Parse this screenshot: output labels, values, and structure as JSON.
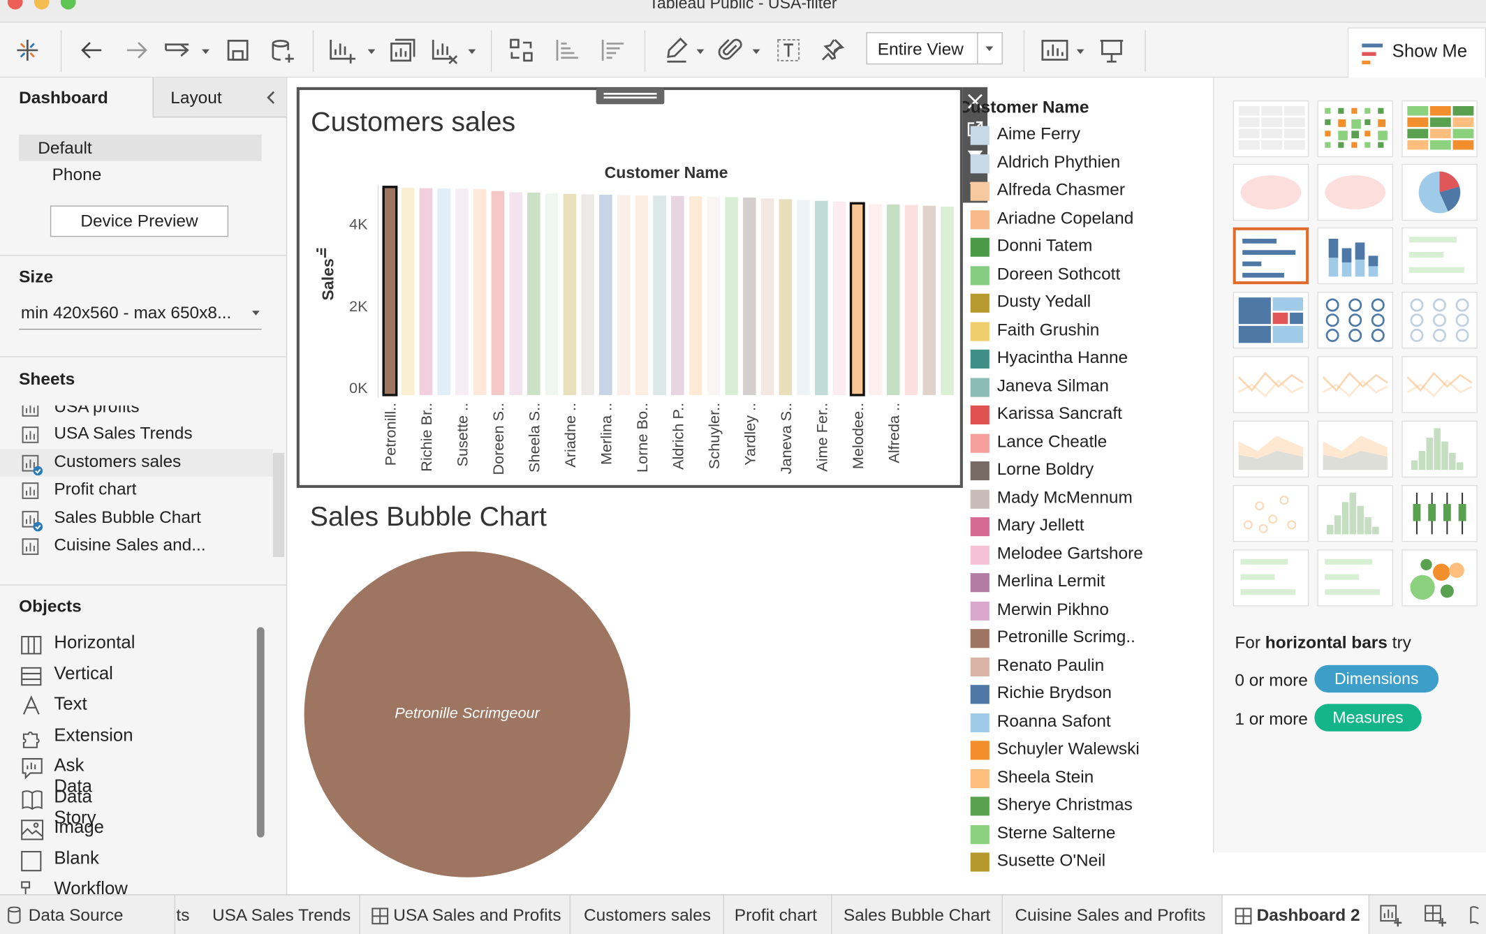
{
  "window": {
    "title": "Tableau Public - USA-filter"
  },
  "toolbar": {
    "fit_select": "Entire View",
    "show_me": "Show Me"
  },
  "sidebar": {
    "tabs": [
      "Dashboard",
      "Layout"
    ],
    "device_options": [
      "Default",
      "Phone"
    ],
    "device_preview_button": "Device Preview",
    "size_header": "Size",
    "size_value": "min 420x560 - max 650x8...",
    "sheets_header": "Sheets",
    "sheets": [
      "USA profits",
      "USA Sales Trends",
      "Customers sales",
      "Profit chart",
      "Sales Bubble Chart",
      "Cuisine Sales and..."
    ],
    "objects_header": "Objects",
    "objects": [
      "Horizontal",
      "Vertical",
      "Text",
      "Extension",
      "Ask Data",
      "Data Story",
      "Image",
      "Blank",
      "Workflow"
    ]
  },
  "customers_chart": {
    "title": "Customers sales"
  },
  "bubble_chart": {
    "title": "Sales Bubble Chart",
    "bubble_label": "Petronille Scrimgeour"
  },
  "chart_data": [
    {
      "type": "bar",
      "title": "Customers sales",
      "xlabel": "Customer Name",
      "ylabel": "Sales",
      "yticks": [
        "4K",
        "2K",
        "0K"
      ],
      "ylim": [
        0,
        5000
      ],
      "categories": [
        "Petronill..",
        "Richie Br..",
        "Susette ..",
        "Doreen S..",
        "Sheela S..",
        "Ariadne ..",
        "Merlina ..",
        "Lorne Bo..",
        "Aldrich P..",
        "Schuyler..",
        "Yardley ..",
        "Janeva S..",
        "Aime Fer..",
        "Melodee..",
        "Alfreda .."
      ],
      "values": [
        4900,
        4880,
        4870,
        4860,
        4860,
        4850,
        4800,
        4770,
        4760,
        4740,
        4730,
        4720,
        4710,
        4700,
        4690,
        4690,
        4680,
        4670,
        4660,
        4650,
        4640,
        4620,
        4600,
        4580,
        4560,
        4540,
        4500,
        4480,
        4470,
        4460,
        4440,
        4420
      ],
      "highlighted": [
        "Petronill..",
        "Aime Fer.."
      ]
    },
    {
      "type": "bubble",
      "title": "Sales Bubble Chart",
      "series": [
        {
          "name": "Petronille Scrimgeour",
          "color": "#9e7560"
        }
      ]
    }
  ],
  "legend": {
    "title": "Customer Name",
    "items": [
      {
        "label": "Aime Ferry",
        "color": "#c8d9e8"
      },
      {
        "label": "Aldrich Phythien",
        "color": "#c8d9e8"
      },
      {
        "label": "Alfreda Chasmer",
        "color": "#f7c9a0"
      },
      {
        "label": "Ariadne Copeland",
        "color": "#f8b98a"
      },
      {
        "label": "Donni Tatem",
        "color": "#4c9a48"
      },
      {
        "label": "Doreen Sothcott",
        "color": "#86cc80"
      },
      {
        "label": "Dusty Yedall",
        "color": "#b79a2f"
      },
      {
        "label": "Faith Grushin",
        "color": "#efcd6c"
      },
      {
        "label": "Hyacintha Hanne",
        "color": "#3f8f86"
      },
      {
        "label": "Janeva Silman",
        "color": "#8cbcb6"
      },
      {
        "label": "Karissa Sancraft",
        "color": "#e05252"
      },
      {
        "label": "Lance Cheatle",
        "color": "#f5a09d"
      },
      {
        "label": "Lorne Boldry",
        "color": "#786b66"
      },
      {
        "label": "Mady McMennum",
        "color": "#c7bcb8"
      },
      {
        "label": "Mary Jellett",
        "color": "#d56b93"
      },
      {
        "label": "Melodee Gartshore",
        "color": "#f6c1d4"
      },
      {
        "label": "Merlina Lermit",
        "color": "#b37ca4"
      },
      {
        "label": "Merwin Pikhno",
        "color": "#d9a8cc"
      },
      {
        "label": "Petronille Scrimg..",
        "color": "#9e7560"
      },
      {
        "label": "Renato Paulin",
        "color": "#d9b4a6"
      },
      {
        "label": "Richie Brydson",
        "color": "#4e79a7"
      },
      {
        "label": "Roanna Safont",
        "color": "#a0cbe8"
      },
      {
        "label": "Schuyler Walewski",
        "color": "#f28e2b"
      },
      {
        "label": "Sheela Stein",
        "color": "#ffbe7d"
      },
      {
        "label": "Sherye Christmas",
        "color": "#59a14f"
      },
      {
        "label": "Sterne Salterne",
        "color": "#8cd17d"
      },
      {
        "label": "Susette O'Neil",
        "color": "#b6992d"
      }
    ]
  },
  "show_me": {
    "hint_prefix": "For ",
    "hint_bold": "horizontal bars",
    "hint_suffix": " try",
    "dimensions_prefix": "0 or more",
    "dimensions_pill": "Dimensions",
    "measures_prefix": "1 or more",
    "measures_pill": "Measures",
    "colors": {
      "dimensions": "#3c9ec9",
      "measures": "#13b589"
    }
  },
  "bottom_tabs": [
    "Data Source",
    "ts",
    "USA Sales Trends",
    "USA Sales and Profits",
    "Customers sales",
    "Profit chart",
    "Sales Bubble Chart",
    "Cuisine Sales and Profits",
    "Dashboard 2"
  ]
}
